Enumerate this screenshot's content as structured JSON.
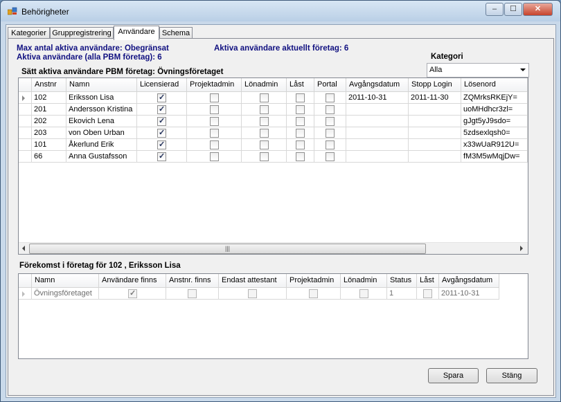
{
  "window": {
    "title": "Behörigheter",
    "minimize": "–",
    "maximize": "☐",
    "close": "✕"
  },
  "tabs": [
    "Kategorier",
    "Gruppregistrering",
    "Användare",
    "Schema"
  ],
  "info": {
    "max_label": "Max antal aktiva användare: Obegränsat",
    "active_all": "Aktiva användare (alla PBM företag): 6",
    "active_current": "Aktiva användare aktuellt företag: 6",
    "section_title": "Sätt aktiva användare PBM företag: Övningsföretaget"
  },
  "kategori": {
    "label": "Kategori",
    "value": "Alla"
  },
  "users_grid": {
    "columns": [
      "Anstnr",
      "Namn",
      "Licensierad",
      "Projektadmin",
      "Lönadmin",
      "Låst",
      "Portal",
      "Avgångsdatum",
      "Stopp Login",
      "Lösenord"
    ],
    "rows": [
      {
        "anstnr": "102",
        "namn": "Eriksson Lisa",
        "licensierad": true,
        "projektadmin": false,
        "lonadmin": false,
        "last": false,
        "portal": false,
        "avgang": "2011-10-31",
        "stopp": "2011-11-30",
        "losen": "ZQMrksRKEjY="
      },
      {
        "anstnr": "201",
        "namn": "Andersson Kristina",
        "licensierad": true,
        "projektadmin": false,
        "lonadmin": false,
        "last": false,
        "portal": false,
        "avgang": "",
        "stopp": "",
        "losen": "uoMHdhcr3zl="
      },
      {
        "anstnr": "202",
        "namn": "Ekovich Lena",
        "licensierad": true,
        "projektadmin": false,
        "lonadmin": false,
        "last": false,
        "portal": false,
        "avgang": "",
        "stopp": "",
        "losen": "gJgt5yJ9sdo="
      },
      {
        "anstnr": "203",
        "namn": "von Oben Urban",
        "licensierad": true,
        "projektadmin": false,
        "lonadmin": false,
        "last": false,
        "portal": false,
        "avgang": "",
        "stopp": "",
        "losen": "5zdsexlqsh0="
      },
      {
        "anstnr": "101",
        "namn": "Åkerlund Erik",
        "licensierad": true,
        "projektadmin": false,
        "lonadmin": false,
        "last": false,
        "portal": false,
        "avgang": "",
        "stopp": "",
        "losen": "x33wUaR912U="
      },
      {
        "anstnr": "66",
        "namn": "Anna Gustafsson",
        "licensierad": true,
        "projektadmin": false,
        "lonadmin": false,
        "last": false,
        "portal": false,
        "avgang": "",
        "stopp": "",
        "losen": "fM3M5wMqjDw="
      }
    ],
    "scroll_grip": "|||"
  },
  "forekomst": {
    "title": "Förekomst i företag för 102 , Eriksson Lisa",
    "columns": [
      "Namn",
      "Användare finns",
      "Anstnr. finns",
      "Endast attestant",
      "Projektadmin",
      "Lönadmin",
      "Status",
      "Låst",
      "Avgångsdatum"
    ],
    "rows": [
      {
        "namn": "Övningsföretaget",
        "anv_finns": true,
        "anstnr_finns": false,
        "endast": false,
        "projektadmin": false,
        "lonadmin": false,
        "status": "1",
        "last": false,
        "avgang": "2011-10-31"
      }
    ]
  },
  "buttons": {
    "spara": "Spara",
    "stang": "Stäng"
  }
}
